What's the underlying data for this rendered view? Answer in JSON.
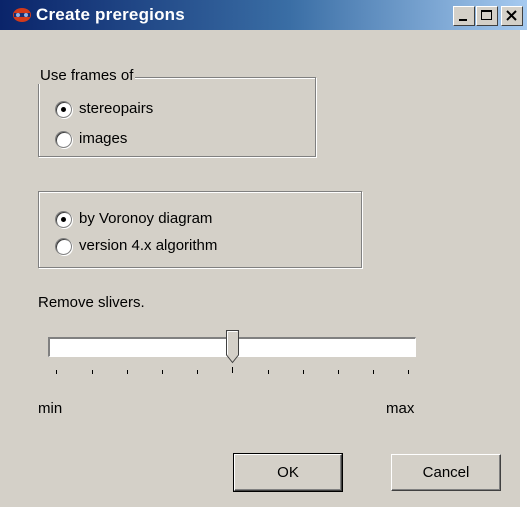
{
  "window": {
    "title": "Create preregions",
    "buttons": [
      "minimize-icon",
      "maximize-icon",
      "close-icon"
    ]
  },
  "frames_group": {
    "legend": "Use frames of",
    "options": [
      {
        "label": "stereopairs",
        "selected": true
      },
      {
        "label": "images",
        "selected": false
      }
    ]
  },
  "method_group": {
    "options": [
      {
        "label": "by Voronoy diagram",
        "selected": true
      },
      {
        "label": "version 4.x algorithm",
        "selected": false
      }
    ]
  },
  "slivers": {
    "label": "Remove slivers.",
    "min_label": "min",
    "max_label": "max",
    "value": 0.5,
    "ticks": 11
  },
  "actions": {
    "ok": "OK",
    "cancel": "Cancel"
  }
}
